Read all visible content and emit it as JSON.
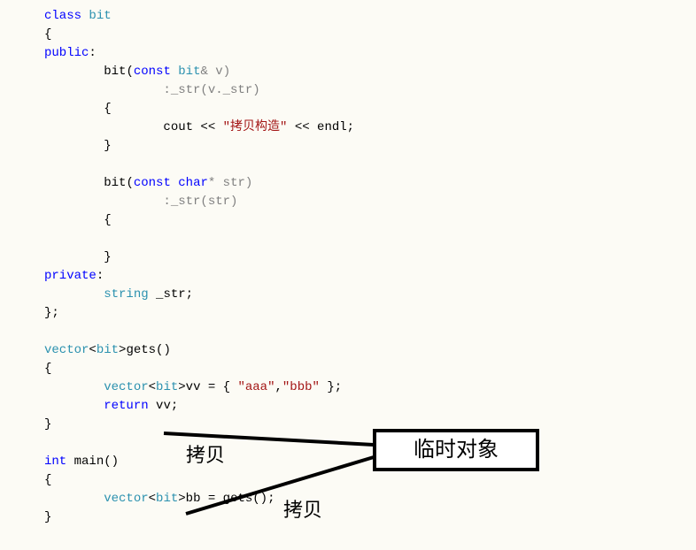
{
  "code": {
    "l1_class": "class",
    "l1_bit": "bit",
    "l2": "{",
    "l3_public": "public",
    "l3_colon": ":",
    "l4_bit": "bit",
    "l4_open": "(",
    "l4_const": "const",
    "l4_bit2": "bit",
    "l4_amp": "& v)",
    "l5_colon": ":_str(v._str)",
    "l6": "{",
    "l7_cout": "cout <<",
    "l7_str": " \"拷贝构造\" ",
    "l7_rest": "<< endl;",
    "l8": "}",
    "l10_bit": "bit",
    "l10_open": "(",
    "l10_const": "const",
    "l10_char": "char",
    "l10_star": "* str)",
    "l11_colon": ":_str(str)",
    "l12": "{",
    "l14": "}",
    "l15_private": "private",
    "l15_colon_p": ":",
    "l16_string": "string",
    "l16_str": " _str;",
    "l17": "};",
    "l19_vector": "vector",
    "l19_lt": "<",
    "l19_bit": "bit",
    "l19_gt": ">",
    "l19_gets": "gets()",
    "l20": "{",
    "l21_vector": "vector",
    "l21_lt": "<",
    "l21_bit": "bit",
    "l21_gt": ">vv = {",
    "l21_s1": " \"aaa\"",
    "l21_comma": ",",
    "l21_s2": "\"bbb\" ",
    "l21_end": "};",
    "l22_return": "return",
    "l22_vv": " vv;",
    "l23": "}",
    "l25_int": "int",
    "l25_main": " main()",
    "l26": "{",
    "l27_vector": "vector",
    "l27_lt": "<",
    "l27_bit": "bit",
    "l27_gt": ">bb = gets();",
    "l28": "}"
  },
  "annotations": {
    "box_label": "临时对象",
    "copy1": "拷贝",
    "copy2": "拷贝"
  }
}
